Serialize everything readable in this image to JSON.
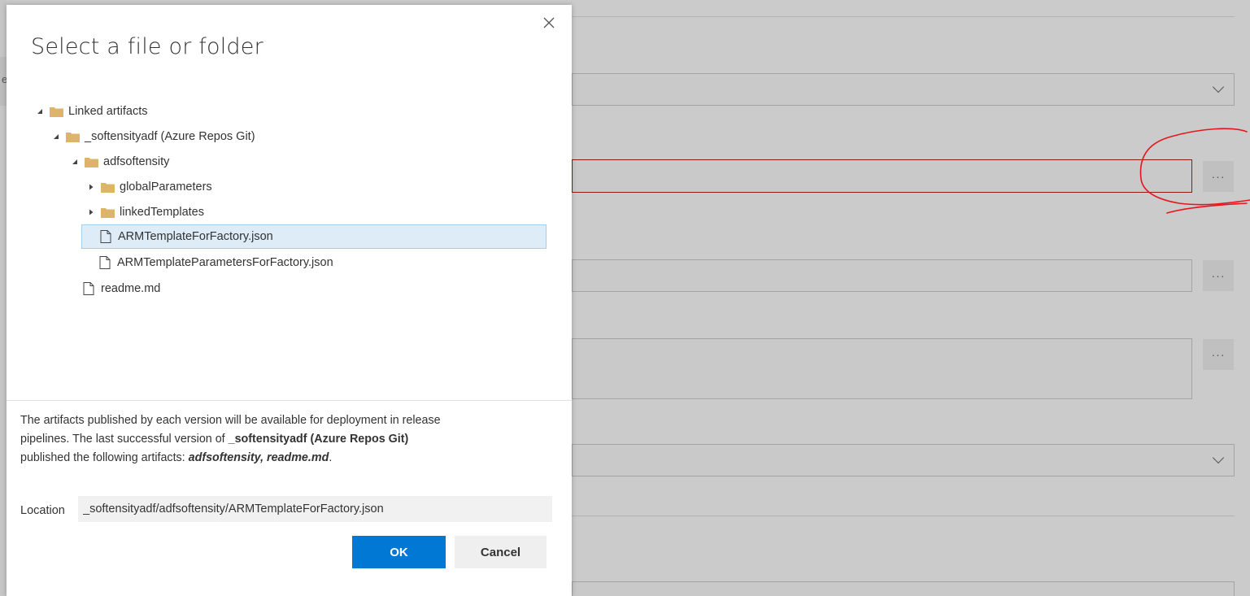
{
  "dialog": {
    "title": "Select a file or folder",
    "close_icon": "close-icon",
    "tree": [
      {
        "label": "Linked artifacts",
        "type": "folder",
        "expanded": true
      },
      {
        "label": "_softensityadf (Azure Repos Git)",
        "type": "folder",
        "expanded": true
      },
      {
        "label": "adfsoftensity",
        "type": "folder",
        "expanded": true
      },
      {
        "label": "globalParameters",
        "type": "folder",
        "expanded": false
      },
      {
        "label": "linkedTemplates",
        "type": "folder",
        "expanded": false
      },
      {
        "label": "ARMTemplateForFactory.json",
        "type": "file",
        "selected": true
      },
      {
        "label": "ARMTemplateParametersForFactory.json",
        "type": "file"
      },
      {
        "label": "readme.md",
        "type": "file"
      }
    ],
    "info": {
      "line1": "The artifacts published by each version will be available for deployment in release",
      "line2_prefix": "pipelines. The last successful version of ",
      "line2_bold": "_softensityadf (Azure Repos Git)",
      "line3_prefix": "published the following artifacts: ",
      "line3_bold_italic": "adfsoftensity, readme.md",
      "line3_suffix": "."
    },
    "location_label": "Location",
    "location_value": "_softensityadf/adfsoftensity/ARMTemplateForFactory.json",
    "ok_label": "OK",
    "cancel_label": "Cancel"
  },
  "background": {
    "left_tab_text": "e",
    "ellipsis": "···"
  },
  "colors": {
    "primary": "#0078d4",
    "selected_bg": "#ddecf7",
    "folder": "#dcb46a",
    "error_border": "#8e1b1b",
    "annotation": "#e8141e"
  }
}
